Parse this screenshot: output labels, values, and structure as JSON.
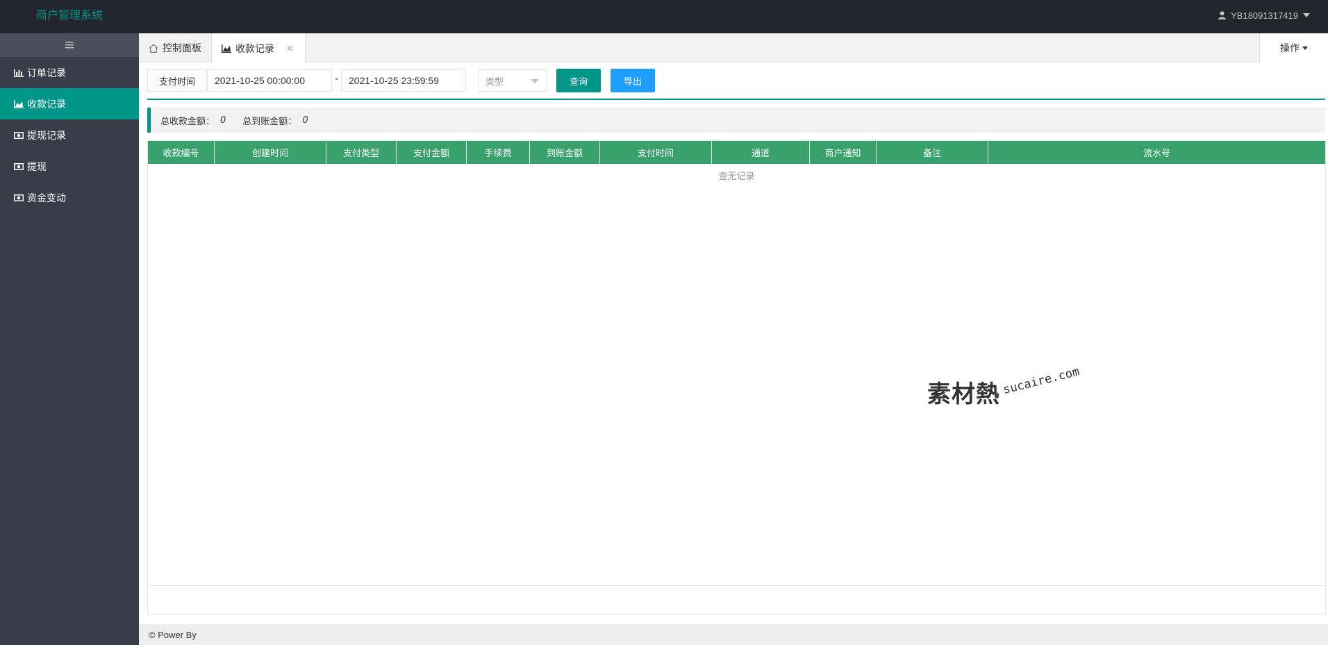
{
  "header": {
    "app_title": "商户管理系统",
    "username": "YB18091317419"
  },
  "sidebar": {
    "items": [
      {
        "label": "订单记录",
        "icon": "bar-chart-icon"
      },
      {
        "label": "收款记录",
        "icon": "area-chart-icon",
        "active": true
      },
      {
        "label": "提现记录",
        "icon": "money-icon"
      },
      {
        "label": "提现",
        "icon": "money-icon"
      },
      {
        "label": "资金变动",
        "icon": "money-icon"
      }
    ]
  },
  "tabs": {
    "items": [
      {
        "label": "控制面板",
        "icon": "home-icon"
      },
      {
        "label": "收款记录",
        "icon": "area-chart-icon",
        "closable": true
      }
    ],
    "close_glyph": "×",
    "ops_label": "操作"
  },
  "filter": {
    "label": "支付时间",
    "start": "2021-10-25 00:00:00",
    "separator": "-",
    "end": "2021-10-25 23:59:59",
    "type_placeholder": "类型",
    "query_label": "查询",
    "export_label": "导出"
  },
  "summary": {
    "total_received_label": "总收款金额：",
    "total_received_value": "0",
    "total_credited_label": "总到账金额：",
    "total_credited_value": "0"
  },
  "table": {
    "columns": [
      "收款编号",
      "创建时间",
      "支付类型",
      "支付金额",
      "手续费",
      "到账金额",
      "支付时间",
      "通道",
      "商户通知",
      "备注",
      "流水号"
    ],
    "empty_text": "查无记录"
  },
  "watermark": {
    "cn": "素材熱",
    "en": "sucaire.com"
  },
  "footer": {
    "text": "© Power By"
  },
  "colors": {
    "accent": "#009688",
    "header_bg": "#23262e",
    "sidebar_bg": "#393d49",
    "table_head": "#39a16b",
    "export": "#1e9fff"
  }
}
